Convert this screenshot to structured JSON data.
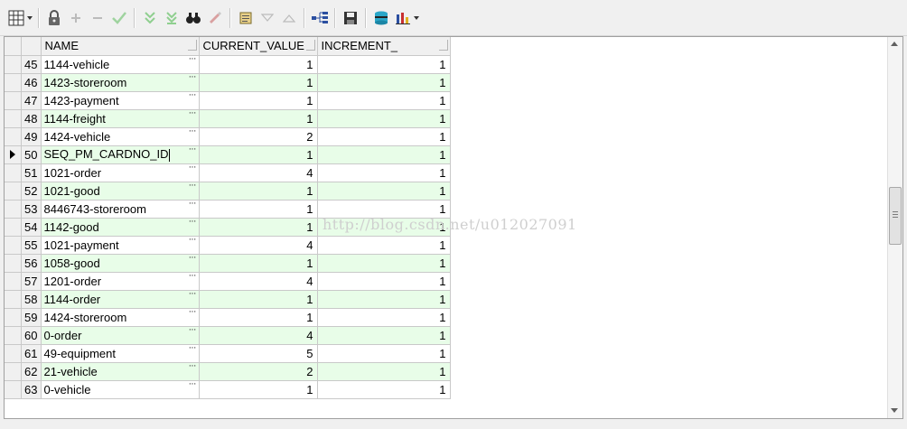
{
  "toolbar": {
    "icons": [
      "grid-icon",
      "lock-icon",
      "add-icon",
      "remove-icon",
      "check-icon",
      "next-record-icon",
      "last-record-icon",
      "find-icon",
      "clear-icon",
      "query-icon",
      "down-icon",
      "up-icon",
      "tree-icon",
      "save-icon",
      "database-icon",
      "chart-icon"
    ]
  },
  "grid": {
    "columns": {
      "name": "NAME",
      "current_value": "CURRENT_VALUE",
      "increment": "INCREMENT_"
    },
    "current_row": 50,
    "rows": [
      {
        "num": "45",
        "name": "1144-vehicle",
        "current_value": "1",
        "increment": "1"
      },
      {
        "num": "46",
        "name": "1423-storeroom",
        "current_value": "1",
        "increment": "1"
      },
      {
        "num": "47",
        "name": "1423-payment",
        "current_value": "1",
        "increment": "1"
      },
      {
        "num": "48",
        "name": "1144-freight",
        "current_value": "1",
        "increment": "1"
      },
      {
        "num": "49",
        "name": "1424-vehicle",
        "current_value": "2",
        "increment": "1"
      },
      {
        "num": "50",
        "name": "SEQ_PM_CARDNO_ID",
        "current_value": "1",
        "increment": "1"
      },
      {
        "num": "51",
        "name": "1021-order",
        "current_value": "4",
        "increment": "1"
      },
      {
        "num": "52",
        "name": "1021-good",
        "current_value": "1",
        "increment": "1"
      },
      {
        "num": "53",
        "name": "8446743-storeroom",
        "current_value": "1",
        "increment": "1"
      },
      {
        "num": "54",
        "name": "1142-good",
        "current_value": "1",
        "increment": "1"
      },
      {
        "num": "55",
        "name": "1021-payment",
        "current_value": "4",
        "increment": "1"
      },
      {
        "num": "56",
        "name": "1058-good",
        "current_value": "1",
        "increment": "1"
      },
      {
        "num": "57",
        "name": "1201-order",
        "current_value": "4",
        "increment": "1"
      },
      {
        "num": "58",
        "name": "1144-order",
        "current_value": "1",
        "increment": "1"
      },
      {
        "num": "59",
        "name": "1424-storeroom",
        "current_value": "1",
        "increment": "1"
      },
      {
        "num": "60",
        "name": "0-order",
        "current_value": "4",
        "increment": "1"
      },
      {
        "num": "61",
        "name": "49-equipment",
        "current_value": "5",
        "increment": "1"
      },
      {
        "num": "62",
        "name": "21-vehicle",
        "current_value": "2",
        "increment": "1"
      },
      {
        "num": "63",
        "name": "0-vehicle",
        "current_value": "1",
        "increment": "1"
      }
    ]
  },
  "watermark": "http://blog.csdn.net/u012027091",
  "ellipsis": "···"
}
